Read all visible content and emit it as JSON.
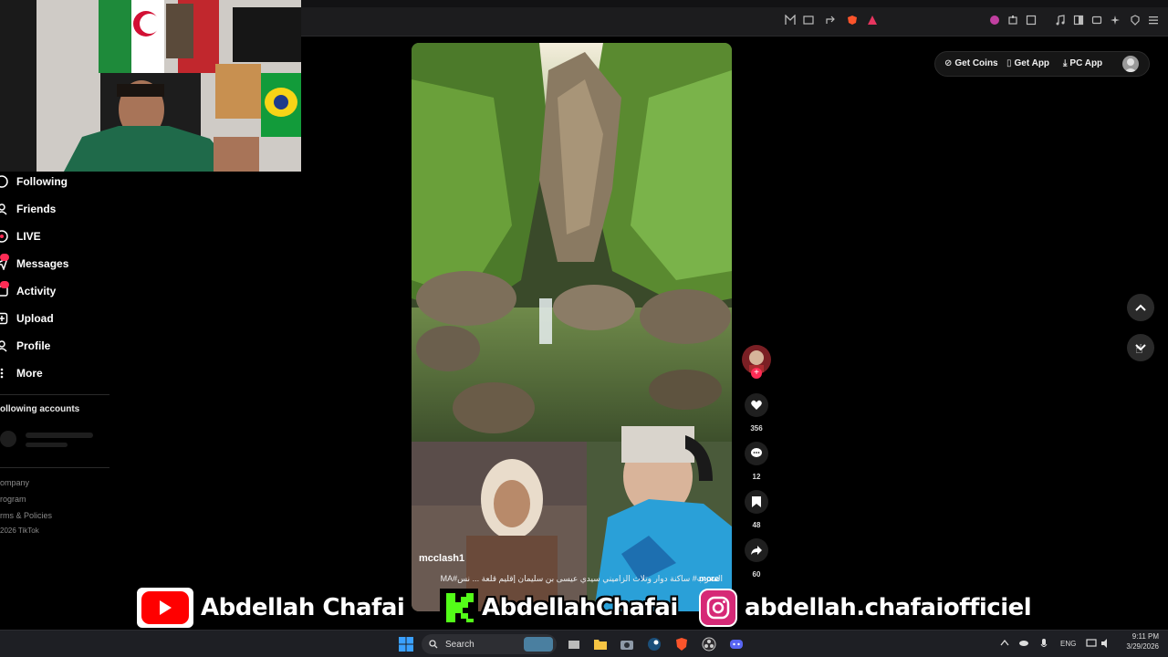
{
  "sidebar": {
    "items": [
      {
        "label": "Following",
        "icon": "following-icon"
      },
      {
        "label": "Friends",
        "icon": "friends-icon"
      },
      {
        "label": "LIVE",
        "icon": "live-icon"
      },
      {
        "label": "Messages",
        "icon": "messages-icon",
        "badge": ""
      },
      {
        "label": "Activity",
        "icon": "activity-icon",
        "badge": ""
      },
      {
        "label": "Upload",
        "icon": "upload-icon"
      },
      {
        "label": "Profile",
        "icon": "profile-icon"
      },
      {
        "label": "More",
        "icon": "more-icon"
      }
    ],
    "following_accounts_title": "ollowing accounts",
    "footer": [
      "ompany",
      "rogram",
      "rms & Policies",
      "2026 TikTok"
    ]
  },
  "header": {
    "get_coins": "Get Coins",
    "get_app": "Get App",
    "pc_app": "PC App"
  },
  "video": {
    "username": "mcclash1",
    "caption": "المغرب# ساكنة دوار وتلاث الزاميني سيدي عيسى بن سليمان إقليم قلعة ... نس#MA",
    "more": "more"
  },
  "actions": {
    "likes": "356",
    "comments": "12",
    "saves": "48",
    "shares": "60"
  },
  "banner": {
    "youtube": "Abdellah Chafai",
    "kick": "AbdellahChafai",
    "instagram": "abdellah.chafaiofficiel"
  },
  "taskbar": {
    "search_label": "Search",
    "lang": "ENG",
    "time": "9:11 PM",
    "date": "3/29/2026"
  },
  "colors": {
    "accent": "#fe2c55",
    "youtube": "#ff0000",
    "kick": "#53fc18"
  }
}
